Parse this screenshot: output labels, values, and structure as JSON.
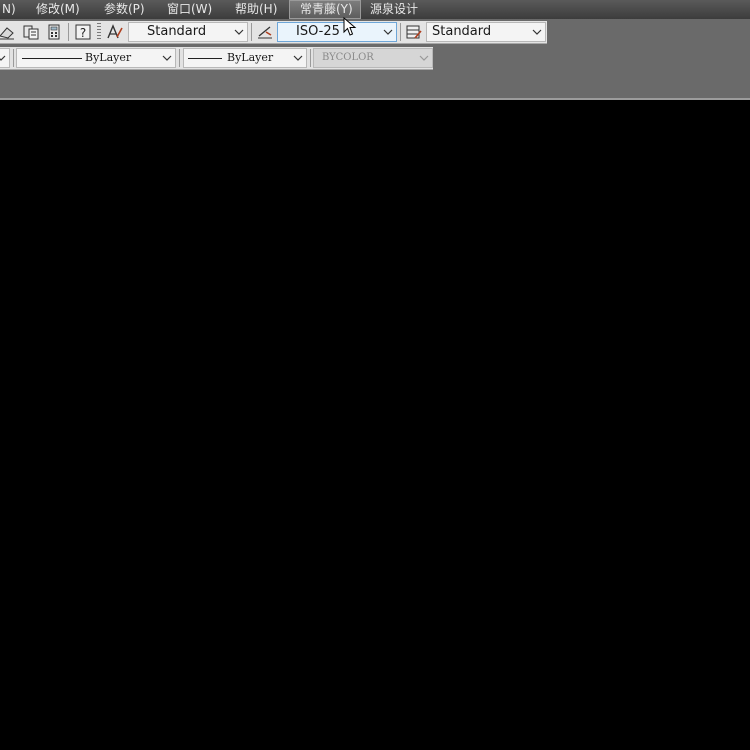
{
  "menubar": {
    "items": [
      {
        "label": "N)"
      },
      {
        "label": "修改(M)"
      },
      {
        "label": "参数(P)"
      },
      {
        "label": "窗口(W)"
      },
      {
        "label": "帮助(H)"
      },
      {
        "label": "常青藤(Y)",
        "active": true
      },
      {
        "label": "源泉设计"
      }
    ]
  },
  "toolbar": {
    "text_style": {
      "value": "Standard"
    },
    "dim_style": {
      "value": "ISO-25"
    },
    "table_style": {
      "value": "Standard"
    },
    "linetype": {
      "value": "ByLayer"
    },
    "lineweight": {
      "value": "ByLayer"
    },
    "plot_style": {
      "value": "BYCOLOR"
    }
  },
  "colors": {
    "menubar": "#4a4a4a",
    "toolbar_bg": "#6a6a6a",
    "panel": "#e4e4e4",
    "canvas": "#000000",
    "highlight": "#6ea6d8"
  }
}
